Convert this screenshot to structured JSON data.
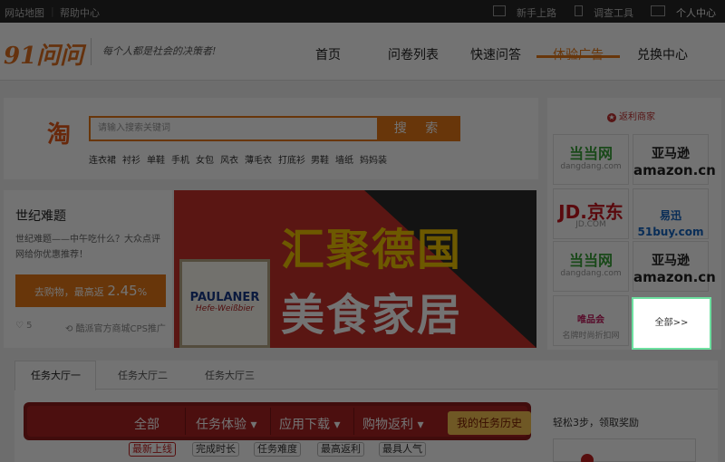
{
  "topbar": {
    "site_map": "网站地图",
    "help": "帮助中心",
    "newbie": "新手上路",
    "survey_tool": "调查工具",
    "personal_center": "个人中心"
  },
  "brand": {
    "logo": "91问问",
    "slogan": "每个人都是社会的决策者!"
  },
  "nav": {
    "items": [
      "首页",
      "问卷列表",
      "快速问答",
      "体验广告",
      "兑换中心"
    ],
    "active": "体验广告"
  },
  "search": {
    "taobao_icon": "淘",
    "placeholder": "请输入搜索关键词",
    "button": "搜 索",
    "keywords": [
      "连衣裙",
      "衬衫",
      "单鞋",
      "手机",
      "女包",
      "风衣",
      "薄毛衣",
      "打底衫",
      "男鞋",
      "墙纸",
      "妈妈装"
    ]
  },
  "promo": {
    "title": "世纪难题",
    "desc": "世纪难题——中午吃什么？大众点评网给你优惠推荐！",
    "buy_label": "去购物，最高返",
    "rate": "2.45",
    "percent": "%",
    "likes": "5",
    "source": "酷派官方商城CPS推广"
  },
  "banner": {
    "line1": "汇聚德国",
    "line2": "美食家居",
    "can_brand": "PAULANER",
    "can_sub": "Hefe-Weißbier"
  },
  "rebate": {
    "title": "返利商家",
    "tiles": [
      {
        "t1": "当当网",
        "t2": "dangdang.com"
      },
      {
        "t1": "亚马逊",
        "t2": "amazon.cn"
      },
      {
        "t1": "JD.京东",
        "t2": "JD.COM"
      },
      {
        "t1": "易迅51buy.com",
        "t2": ""
      },
      {
        "t1": "当当网",
        "t2": "dangdang.com"
      },
      {
        "t1": "亚马逊",
        "t2": "amazon.cn"
      },
      {
        "t1": "唯品会",
        "t2": "名牌时尚折扣网"
      }
    ],
    "all": "全部>>"
  },
  "tabs": [
    "任务大厅一",
    "任务大厅二",
    "任务大厅三"
  ],
  "taskbar": {
    "all": "全部",
    "experience": "任务体验 ▾",
    "download": "应用下载 ▾",
    "shopping": "购物返利 ▾",
    "my_tasks": "我的任务历史"
  },
  "filters": [
    "最新上线",
    "完成时长",
    "任务难度",
    "最高返利",
    "最具人气"
  ],
  "side": {
    "easy": "轻松3步，领取奖励"
  },
  "colors": {
    "accent": "#e67817",
    "red": "#a82323"
  }
}
